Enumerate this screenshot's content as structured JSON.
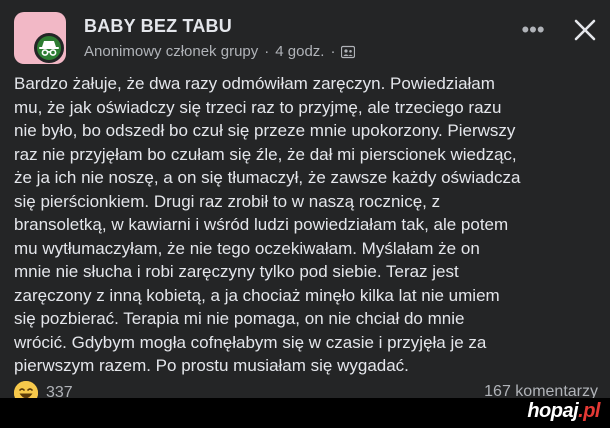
{
  "group": {
    "name": "BABY BEZ TABU",
    "author": "Anonimowy członek grupy",
    "time": "4 godz.",
    "separator": "·",
    "avatar_color": "#f2b8c6",
    "badge_color": "#2e7d32",
    "badge_icon": "incognito-icon",
    "audience_icon": "group-members-icon"
  },
  "controls": {
    "more_icon": "more-dots-icon",
    "more_glyph": "•••",
    "close_icon": "close-icon"
  },
  "post": {
    "lines": [
      "Bardzo żałuje, że dwa razy odmówiłam zaręczyn. Powiedziałam",
      "mu, że jak oświadczy się trzeci raz to przyjmę, ale trzeciego razu",
      "nie było, bo odszedł bo czuł się przeze mnie upokorzony. Pierwszy",
      "raz nie przyjęłam bo czułam się źle, że dał mi pierscionek wiedząc,",
      "że ja ich nie noszę, a on się tłumaczył, że zawsze każdy oświadcza",
      "się pierścionkiem. Drugi raz zrobił to w naszą rocznicę, z",
      "bransoletką, w kawiarni i wśród ludzi powiedziałam tak, ale potem",
      "mu wytłumaczyłam, że nie tego oczekiwałam. Myślałam że on",
      "mnie nie słucha i robi zaręczyny tylko pod siebie. Teraz jest",
      "zaręczony z inną kobietą, a ja chociaż minęło kilka lat nie umiem",
      "się pozbierać. Terapia mi nie pomaga, on nie chciał do mnie",
      "wrócić. Gdybym mogła cofnęłabym się w czasie i przyjęła je za",
      "pierwszym razem. Po prostu musiałam się wygadać."
    ]
  },
  "stats": {
    "reaction_icon": "haha-reaction-icon",
    "reactions": "337",
    "comments": "167 komentarzy"
  },
  "watermark": {
    "name": "hopaj",
    "tld": ".pl"
  },
  "colors": {
    "background": "#242526",
    "text": "#e4e6eb",
    "secondary_text": "#b0b3b8",
    "watermark_accent": "#e53935"
  }
}
